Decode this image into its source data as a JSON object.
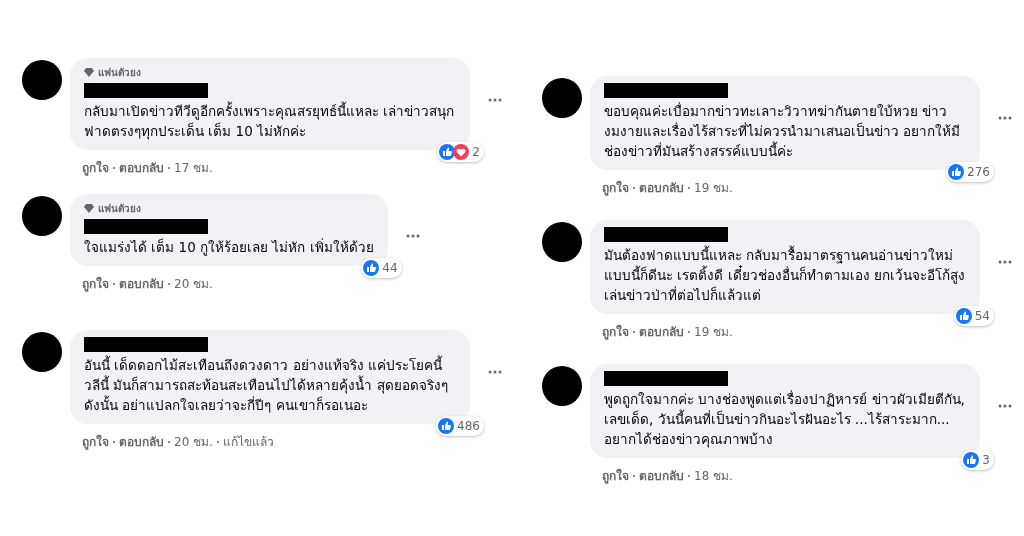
{
  "columns": [
    {
      "comments": [
        {
          "badge": "แฟนตัวยง",
          "name_redacted": true,
          "text": "กลับมาเปิดข่าวทีวีดูอีกครั้งเพราะคุณสรยุทธ์นี้แหละ เล่าข่าวสนุก ฟาดตรงๆทุกประเด็น เต็ม 10 ไม่หักค่ะ",
          "reactions": [
            {
              "kind": "like"
            },
            {
              "kind": "love"
            }
          ],
          "reaction_count": "2",
          "actions": [
            "ถูกใจ",
            "ตอบกลับ",
            "17 ชม."
          ]
        },
        {
          "badge": "แฟนตัวยง",
          "name_redacted": true,
          "text": "ใจแมร่งได้ เต็ม 10 กูให้ร้อยเลย ไม่หัก เพิ่มให้ด้วย",
          "reactions": [
            {
              "kind": "like"
            }
          ],
          "reaction_count": "44",
          "actions": [
            "ถูกใจ",
            "ตอบกลับ",
            "20 ชม."
          ]
        },
        {
          "name_redacted": true,
          "text": "อันนี้ เด็ดดอกไม้สะเทือนถึงดวงดาว อย่างแท้จริง แค่ประโยคนี้วลีนี้ มันก็สามารถสะท้อนสะเทือนไปได้หลายคุ้งน้ำ สุดยอดจริงๆ ดังนั้น อย่าแปลกใจเลยว่าจะกี่ปีๆ คนเขาก็รอเนอะ",
          "reactions": [
            {
              "kind": "like"
            }
          ],
          "reaction_count": "486",
          "actions": [
            "ถูกใจ",
            "ตอบกลับ",
            "20 ชม.",
            "แก้ไขแล้ว"
          ]
        }
      ]
    },
    {
      "comments": [
        {
          "name_redacted": true,
          "text": "ขอบคุณค่ะเบื่อมากข่าวทะเลาะวิวาทฆ่ากันตายใบ้หวย ข่าวงมงายและเรื่องไร้สาระที่ไม่ควรนำมาเสนอเป็นข่าว อยากให้มีช่องข่าวที่มันสร้างสรรค์แบบนี้ค่ะ",
          "reactions": [
            {
              "kind": "like"
            }
          ],
          "reaction_count": "276",
          "actions": [
            "ถูกใจ",
            "ตอบกลับ",
            "19 ชม."
          ]
        },
        {
          "name_redacted": true,
          "text": "มันต้องฟาดแบบนี้แหละ กลับมารื้อมาตรฐานคนอ่านข่าวใหม่ แบบนี้ก็ดีนะ เรตติ้งดี เดี๋ยวช่องอื่นก็ทำตามเอง ยกเว้นจะอีโก้สูงเล่นข่าวป่าที่ต่อไปก็แล้วแต่",
          "reactions": [
            {
              "kind": "like"
            }
          ],
          "reaction_count": "54",
          "actions": [
            "ถูกใจ",
            "ตอบกลับ",
            "19 ชม."
          ]
        },
        {
          "name_redacted": true,
          "text": "พูดถูกใจมากค่ะ บางช่องพูดแต่เรื่องปาฏิหารย์ ข่าวผัวเมียตีกัน, เลขเด็ด, วันนี้คนที่เป็นข่าวกินอะไรฝันอะไร ...ไร้สาระมาก... อยากได้ช่องข่าวคุณภาพบ้าง",
          "reactions": [
            {
              "kind": "like"
            }
          ],
          "reaction_count": "3",
          "actions": [
            "ถูกใจ",
            "ตอบกลับ",
            "18 ชม."
          ]
        }
      ]
    }
  ]
}
